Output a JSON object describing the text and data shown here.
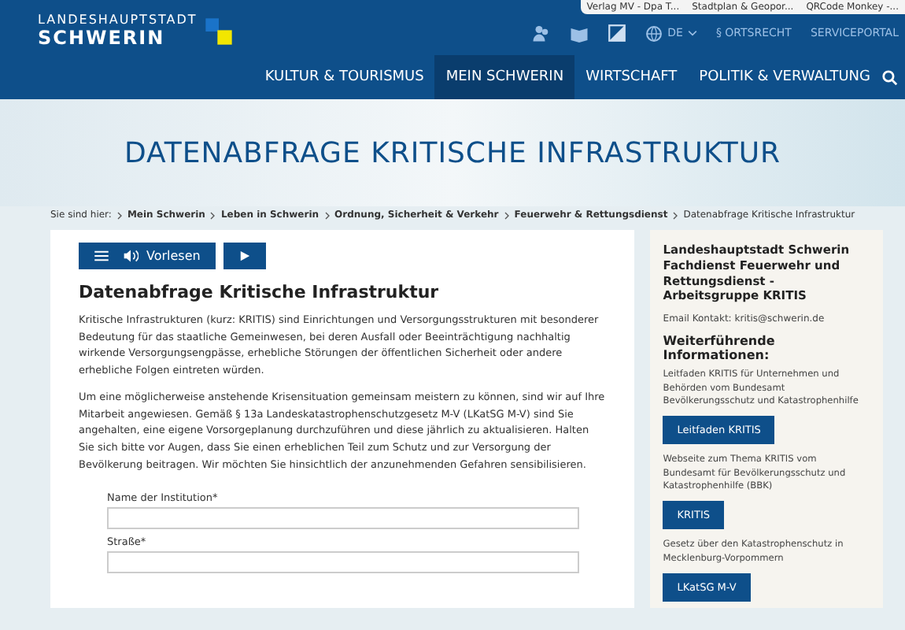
{
  "bookmarks": [
    "Verlag MV - Dpa T...",
    "Stadtplan & Geopor...",
    "QRCode Monkey -..."
  ],
  "logo": {
    "line1": "LANDESHAUPTSTADT",
    "line2": "SCHWERIN"
  },
  "utility": {
    "language": "DE",
    "ortsrecht": "§ ORTSRECHT",
    "service": "SERVICEPORTAL"
  },
  "nav": [
    {
      "label": "KULTUR & TOURISMUS",
      "selected": false
    },
    {
      "label": "MEIN SCHWERIN",
      "selected": true
    },
    {
      "label": "WIRTSCHAFT",
      "selected": false
    },
    {
      "label": "POLITIK & VERWALTUNG",
      "selected": false
    }
  ],
  "page_title": "DATENABFRAGE KRITISCHE INFRASTRUKTUR",
  "breadcrumb": {
    "prefix": "Sie sind hier:",
    "items": [
      "Mein Schwerin",
      "Leben in Schwerin",
      "Ordnung, Sicherheit & Verkehr",
      "Feuerwehr & Rettungsdienst",
      "Datenabfrage Kritische Infrastruktur"
    ]
  },
  "reader": {
    "label": "Vorlesen"
  },
  "article": {
    "heading": "Datenabfrage Kritische Infrastruktur",
    "paragraphs": [
      "Kritische Infrastrukturen (kurz: KRITIS) sind Einrichtungen und Versorgungsstrukturen mit besonderer Bedeutung für das staatliche Gemeinwesen, bei deren Ausfall oder Beeinträchtigung nachhaltig wirkende Versorgungsengpässe, erhebliche Störungen der öffentlichen Sicherheit oder andere erhebliche Folgen eintreten würden.",
      "Um eine möglicherweise anstehende Krisensituation gemeinsam meistern zu können, sind wir auf Ihre Mitarbeit angewiesen. Gemäß § 13a Landeskatastrophenschutzgesetz M-V (LKatSG M-V) sind Sie angehalten, eine eigene Vorsorgeplanung durchzuführen und diese jährlich zu aktualisieren. Halten Sie sich bitte vor Augen, dass Sie einen erheblichen Teil zum Schutz und zur Versorgung der Bevölkerung beitragen. Wir möchten Sie hinsichtlich der anzunehmenden Gefahren sensibilisieren."
    ]
  },
  "form": {
    "fields": [
      {
        "label": "Name der Institution*"
      },
      {
        "label": "Straße*"
      }
    ]
  },
  "sidebar": {
    "org": "Landeshauptstadt Schwerin Fachdienst Feuerwehr und Rettungsdienst - Arbeitsgruppe KRITIS",
    "contact_label": "Email Kontakt:",
    "contact_email": "kritis@schwerin.de",
    "heading": "Weiterführende Informationen:",
    "links": [
      {
        "text": "Leitfaden KRITIS für Unternehmen und Behörden vom Bundesamt Bevölkerungsschutz und Katastrophenhilfe",
        "button": "Leitfaden KRITIS"
      },
      {
        "text": "Webseite zum Thema KRITIS vom Bundesamt für Bevölkerungsschutz und Katastrophenhilfe (BBK)",
        "button": "KRITIS"
      },
      {
        "text": "Gesetz über den Katastrophenschutz in Mecklenburg-Vorpommern",
        "button": "LKatSG M-V"
      }
    ]
  }
}
